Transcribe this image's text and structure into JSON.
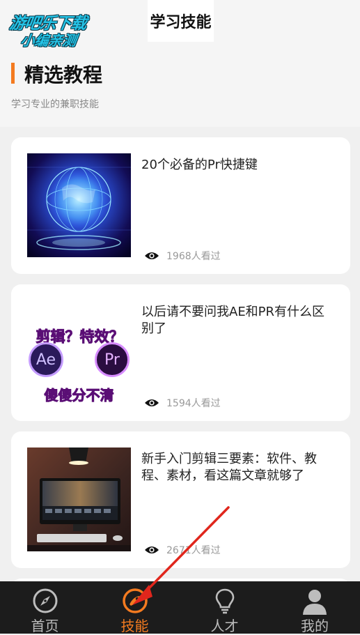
{
  "watermark": {
    "line1": "游吧乐下载",
    "line2": "小编亲测"
  },
  "header": {
    "title": "学习技能"
  },
  "section": {
    "title": "精选教程",
    "subtitle": "学习专业的兼职技能"
  },
  "cards": [
    {
      "title": "20个必备的Pr快捷键",
      "views": "1968人看过",
      "thumb": "globe-thumbnail"
    },
    {
      "title": "以后请不要问我AE和PR有什么区别了",
      "views": "1594人看过",
      "thumb": "ae-pr-thumbnail",
      "thumb_text": {
        "top": "剪辑？特效？",
        "ae": "Ae",
        "pr": "Pr",
        "bottom": "傻傻分不清"
      }
    },
    {
      "title": "新手入门剪辑三要素：软件、教程、素材，看这篇文章就够了",
      "views": "2671人看过",
      "thumb": "studio-thumbnail"
    }
  ],
  "tabbar": {
    "items": [
      {
        "label": "首页",
        "icon": "compass-icon",
        "active": false
      },
      {
        "label": "技能",
        "icon": "skill-icon",
        "active": true
      },
      {
        "label": "人才",
        "icon": "lightbulb-icon",
        "active": false
      },
      {
        "label": "我的",
        "icon": "person-icon",
        "active": false
      }
    ]
  },
  "colors": {
    "accent": "#f47b20",
    "tabbar_bg": "#1c1c1c",
    "annotation_arrow": "#e0261c"
  }
}
